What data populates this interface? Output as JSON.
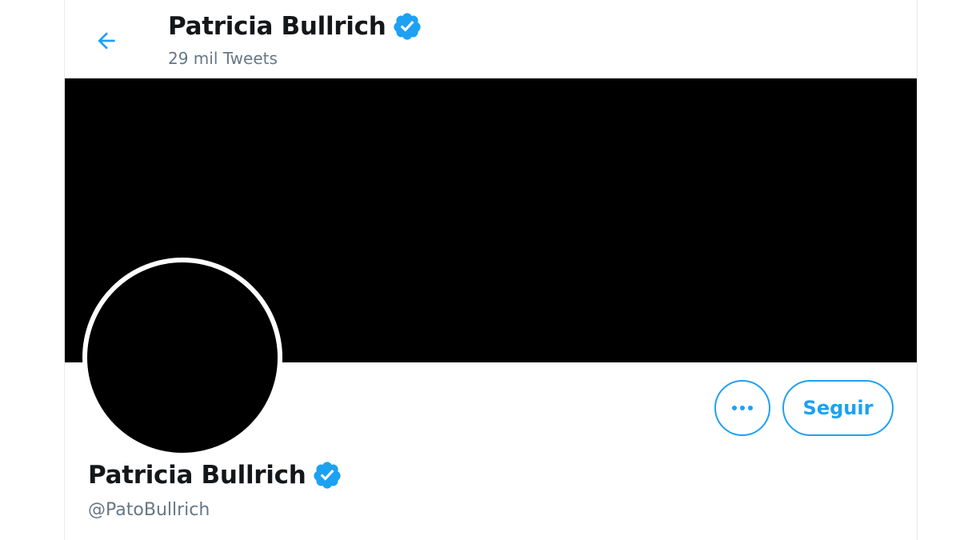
{
  "header": {
    "name": "Patricia Bullrich",
    "tweet_count": "29 mil Tweets"
  },
  "profile": {
    "name": "Patricia Bullrich",
    "handle": "@PatoBullrich"
  },
  "actions": {
    "follow_label": "Seguir",
    "more_icon": "ellipsis-icon"
  },
  "icons": {
    "back": "back-arrow-icon",
    "verified": "verified-badge-icon"
  },
  "colors": {
    "accent": "#1da1f2",
    "banner": "#000000",
    "text_primary": "#14171a",
    "text_secondary": "#657786"
  }
}
